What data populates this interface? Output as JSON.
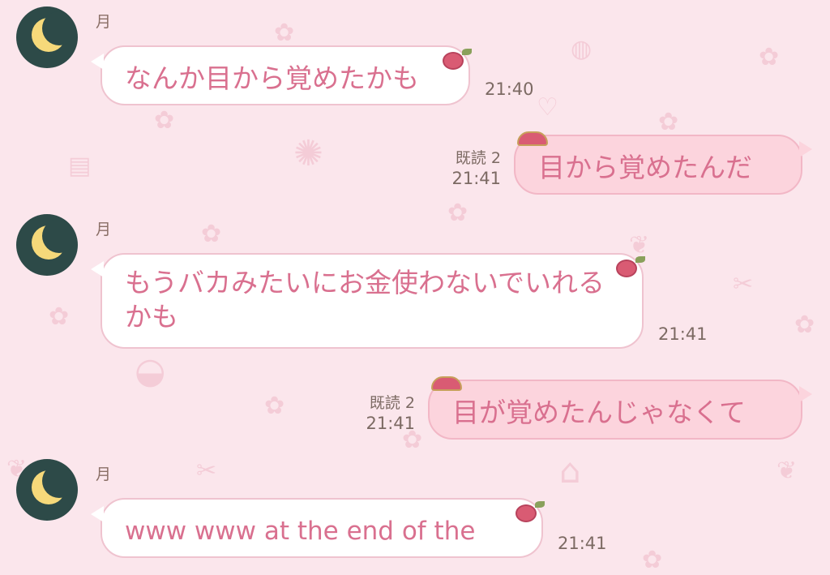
{
  "sender_name": "月",
  "messages": [
    {
      "text": "なんか目から覚めたかも",
      "time": "21:40"
    },
    {
      "text": "目から覚めたんだ",
      "read": "既読 2",
      "time": "21:41"
    },
    {
      "text": "もうバカみたいにお金使わないでいれるかも",
      "time": "21:41"
    },
    {
      "text": "目が覚めたんじゃなくて",
      "read": "既読 2",
      "time": "21:41"
    },
    {
      "text": "www www at the end of the",
      "time": "21:41"
    }
  ],
  "icons": {
    "avatar": "crescent-moon-icon",
    "incoming_sticker": "rose-icon",
    "outgoing_sticker": "hat-icon"
  },
  "colors": {
    "background": "#fbe6ec",
    "incoming_bubble": "#ffffff",
    "outgoing_bubble": "#fcd4dd",
    "bubble_text": "#d9708f",
    "avatar_bg": "#2d4a48",
    "moon": "#f6d97a"
  }
}
